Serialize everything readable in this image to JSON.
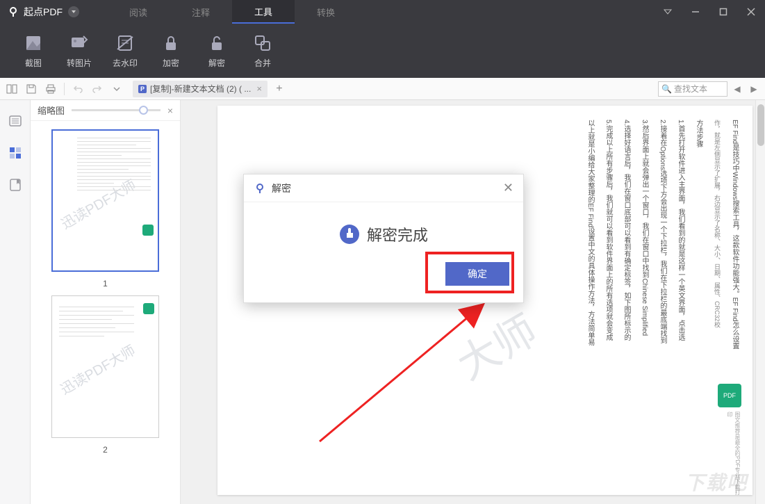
{
  "app": {
    "name": "起点PDF"
  },
  "topTabs": {
    "read": "阅读",
    "annotate": "注释",
    "tools": "工具",
    "convert": "转换"
  },
  "toolbarItems": {
    "screenshot": "截图",
    "toImage": "转图片",
    "removeWatermark": "去水印",
    "encrypt": "加密",
    "decrypt": "解密",
    "merge": "合并"
  },
  "docTab": {
    "label": "[复制]-新建文本文档 (2) ( ...",
    "badge": "P"
  },
  "search": {
    "placeholder": "查找文本"
  },
  "thumbPanel": {
    "title": "缩略图",
    "page1": "1",
    "page2": "2"
  },
  "watermark": "迅读PDF大师",
  "pageBadge": "PDF",
  "downloadWatermark": "下载吧",
  "dialog": {
    "title": "解密",
    "message": "解密完成",
    "okLabel": "确定"
  }
}
